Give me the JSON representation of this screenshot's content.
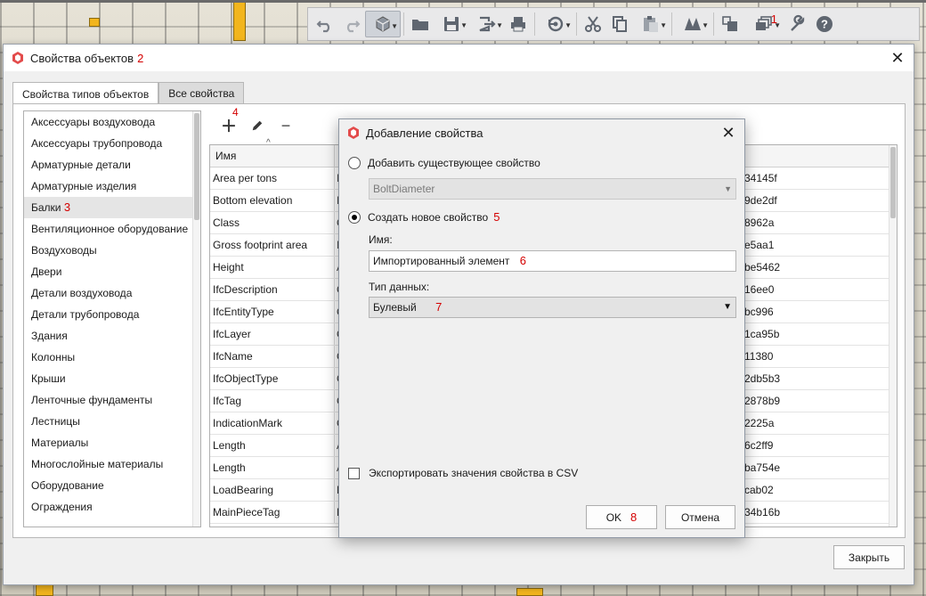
{
  "toolbar": {
    "buttons": [
      "undo-icon",
      "redo-icon",
      "view-cube-icon",
      "open-folder-icon",
      "save-icon",
      "export-icon",
      "print-icon",
      "sync-icon",
      "cut-icon",
      "copy-icon",
      "paste-icon",
      "model-icon",
      "layers-icon",
      "object-properties-icon",
      "wrench-icon",
      "help-icon"
    ],
    "marker": "1"
  },
  "properties_dialog": {
    "title": "Свойства объектов",
    "marker": "2",
    "tabs": [
      "Свойства типов объектов",
      "Все свойства"
    ],
    "types": [
      "Аксессуары воздуховода",
      "Аксессуары трубопровода",
      "Арматурные детали",
      "Арматурные изделия",
      "Балки",
      "Вентиляционное оборудование",
      "Воздуховоды",
      "Двери",
      "Детали воздуховода",
      "Детали трубопровода",
      "Здания",
      "Колонны",
      "Крыши",
      "Ленточные фундаменты",
      "Лестницы",
      "Материалы",
      "Многослойные материалы",
      "Оборудование",
      "Ограждения"
    ],
    "selected_type_marker": "3",
    "add_marker": "4",
    "grid": {
      "header": "Имя",
      "rows": [
        {
          "name": "Area per tons",
          "type": "I",
          "id": "34145f"
        },
        {
          "name": "Bottom elevation",
          "type": "I",
          "id": "9de2df"
        },
        {
          "name": "Class",
          "type": "C",
          "id": "8962a"
        },
        {
          "name": "Gross footprint area",
          "type": "I",
          "id": "e5aa1"
        },
        {
          "name": "Height",
          "type": "A",
          "id": "be5462"
        },
        {
          "name": "IfcDescription",
          "type": "C",
          "id": "16ee0"
        },
        {
          "name": "IfcEntityType",
          "type": "C",
          "id": "bc996"
        },
        {
          "name": "IfcLayer",
          "type": "C",
          "id": "1ca95b"
        },
        {
          "name": "IfcName",
          "type": "C",
          "id": "11380"
        },
        {
          "name": "IfcObjectType",
          "type": "C",
          "id": "2db5b3"
        },
        {
          "name": "IfcTag",
          "type": "C",
          "id": "2878b9"
        },
        {
          "name": "IndicationMark",
          "type": "C",
          "id": "2225a"
        },
        {
          "name": "Length",
          "type": "A",
          "id": "6c2ff9"
        },
        {
          "name": "Length",
          "type": "A",
          "id": "ba754e"
        },
        {
          "name": "LoadBearing",
          "type": "E",
          "id": "cab02"
        },
        {
          "name": "MainPieceTag",
          "type": "E",
          "id": "34b16b"
        }
      ]
    },
    "close_label": "Закрыть"
  },
  "add_property": {
    "title": "Добавление свойства",
    "existing_label": "Добавить существующее свойство",
    "existing_value": "BoltDiameter",
    "new_label": "Создать новое свойство",
    "new_marker": "5",
    "name_label": "Имя:",
    "name_value": "Импортированный элемент",
    "name_marker": "6",
    "type_label": "Тип данных:",
    "type_value": "Булевый",
    "type_marker": "7",
    "export_label": "Экспортировать значения свойства в CSV",
    "ok_label": "OK",
    "ok_marker": "8",
    "cancel_label": "Отмена"
  }
}
